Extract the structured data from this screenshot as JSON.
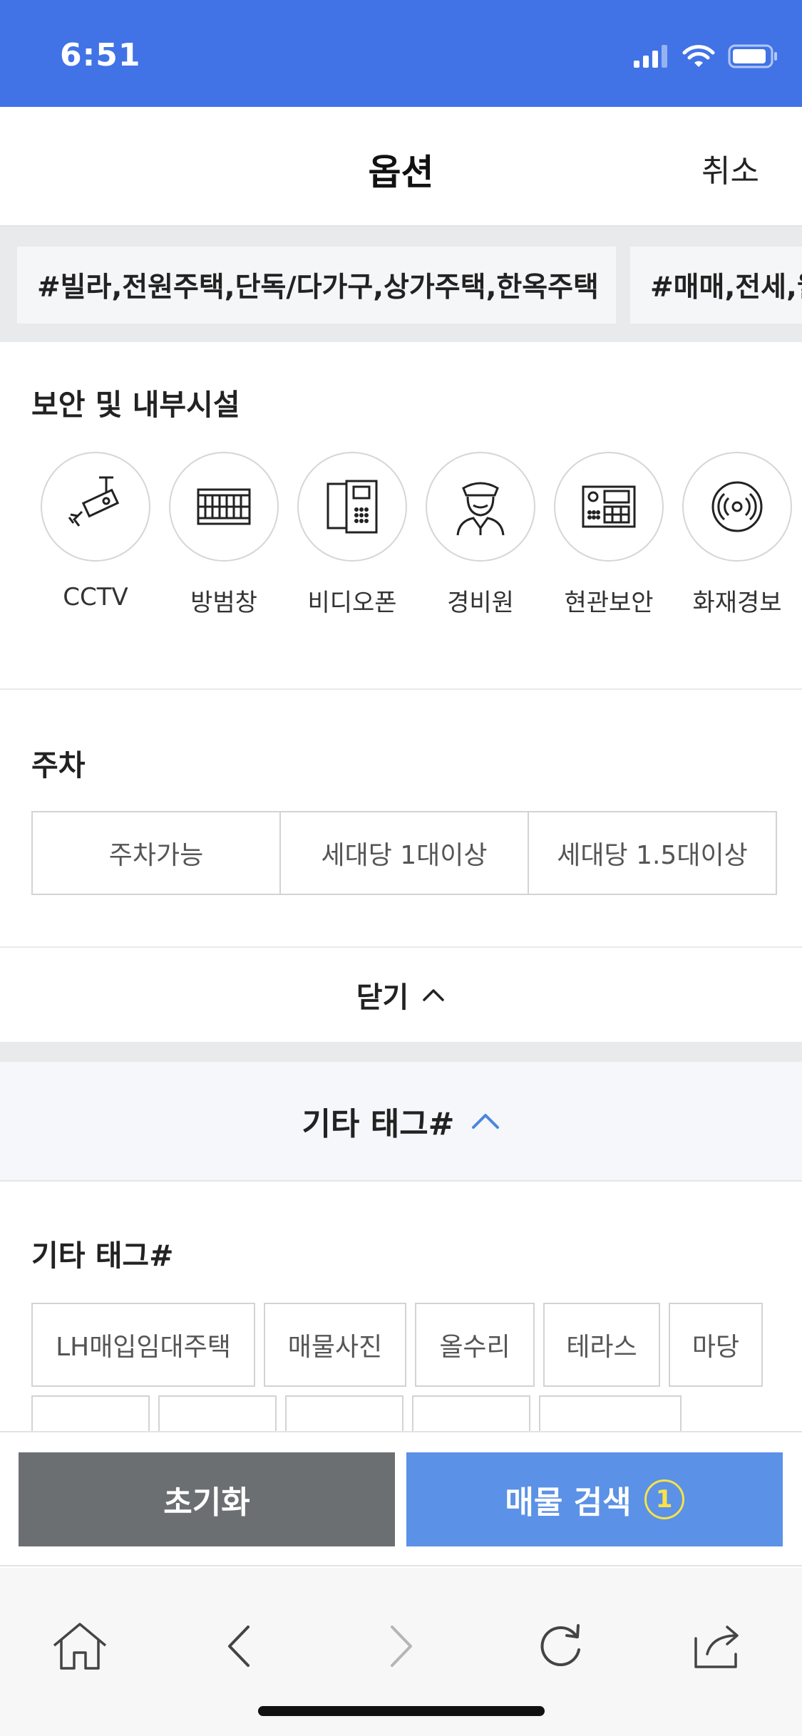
{
  "status_bar": {
    "time": "6:51"
  },
  "header": {
    "title": "옵션",
    "cancel": "취소"
  },
  "tag_strip": [
    "#빌라,전원주택,단독/다가구,상가주택,한옥주택",
    "#매매,전세,월세"
  ],
  "security": {
    "title": "보안 및 내부시설",
    "items": [
      {
        "label": "CCTV",
        "icon": "cctv-icon"
      },
      {
        "label": "방범창",
        "icon": "window-grille-icon"
      },
      {
        "label": "비디오폰",
        "icon": "video-phone-icon"
      },
      {
        "label": "경비원",
        "icon": "security-guard-icon"
      },
      {
        "label": "현관보안",
        "icon": "entrance-lock-icon"
      },
      {
        "label": "화재경보",
        "icon": "fire-alarm-icon"
      }
    ]
  },
  "parking": {
    "title": "주차",
    "options": [
      "주차가능",
      "세대당 1대이상",
      "세대당 1.5대이상"
    ]
  },
  "close": {
    "label": "닫기"
  },
  "etc": {
    "header_label": "기타 태그#",
    "title": "기타 태그#",
    "tags": [
      "LH매입임대주택",
      "매물사진",
      "올수리",
      "테라스",
      "마당"
    ]
  },
  "actions": {
    "reset": "초기화",
    "search": "매물 검색",
    "search_count": "1"
  },
  "colors": {
    "status_bar": "#4173e6",
    "search_button": "#5b91e6",
    "reset_button": "#6c6f72",
    "count_badge": "#f6e24a",
    "accent_chevron": "#4a86e0"
  }
}
